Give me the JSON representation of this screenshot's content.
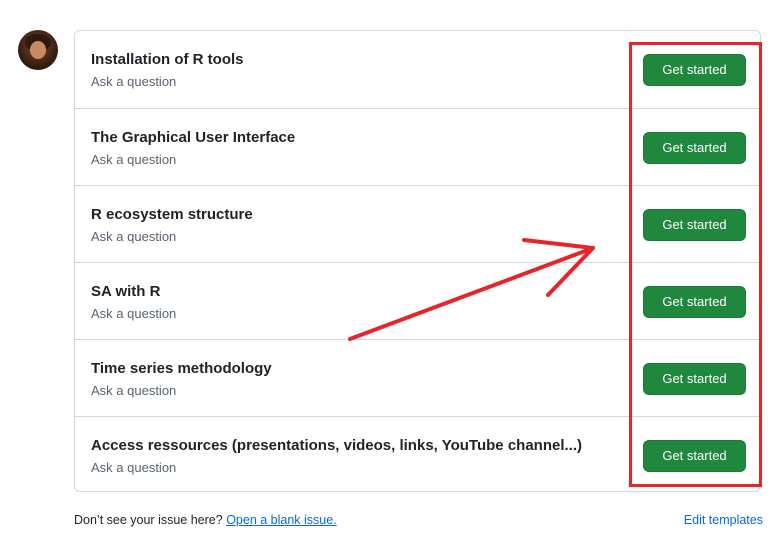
{
  "templates": [
    {
      "title": "Installation of R tools",
      "subtitle": "Ask a question",
      "button": "Get started"
    },
    {
      "title": "The Graphical User Interface",
      "subtitle": "Ask a question",
      "button": "Get started"
    },
    {
      "title": "R ecosystem structure",
      "subtitle": "Ask a question",
      "button": "Get started"
    },
    {
      "title": "SA with R",
      "subtitle": "Ask a question",
      "button": "Get started"
    },
    {
      "title": "Time series methodology",
      "subtitle": "Ask a question",
      "button": "Get started"
    },
    {
      "title": "Access ressources (presentations, videos, links, YouTube channel...)",
      "subtitle": "Ask a question",
      "button": "Get started"
    }
  ],
  "footer": {
    "prompt": "Don’t see your issue here?",
    "blank_issue_link": "Open a blank issue.",
    "edit_templates_link": "Edit templates"
  },
  "annotation_color": "#e5252a",
  "button_color": "#1f883d"
}
